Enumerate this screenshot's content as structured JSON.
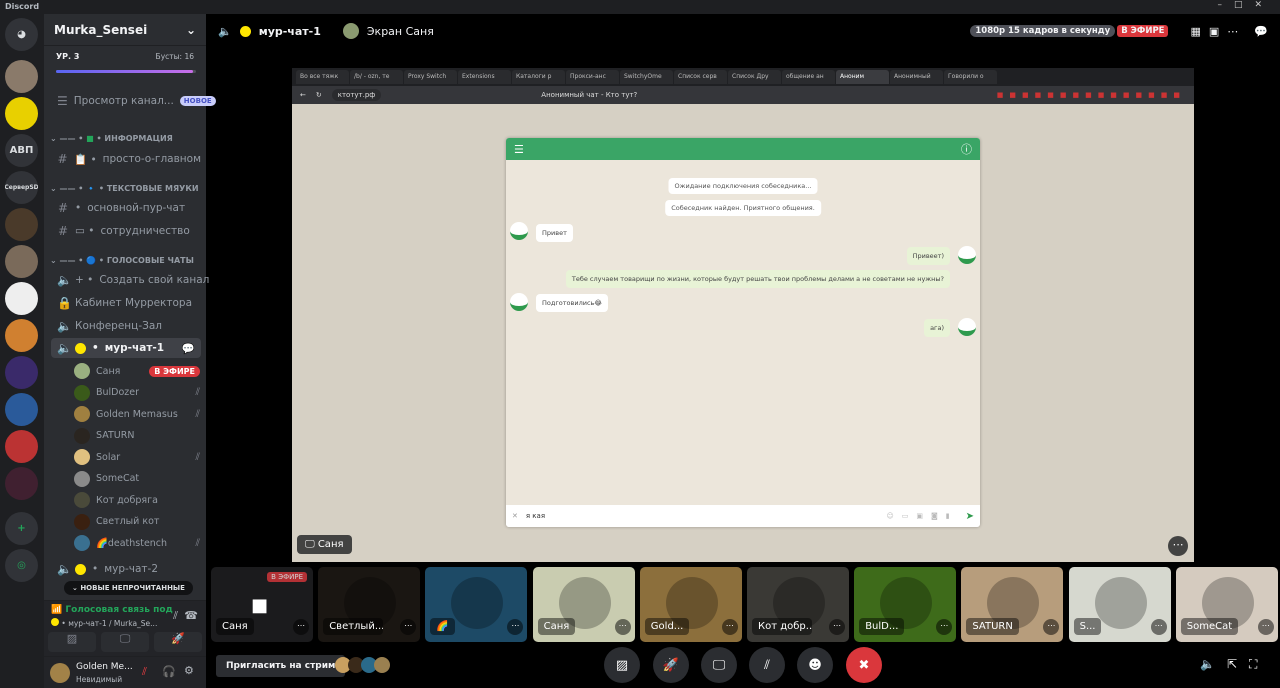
{
  "app": {
    "title": "Discord"
  },
  "rail": {
    "servers": [
      {
        "label": ""
      },
      {
        "label": ""
      },
      {
        "label": "АВП"
      },
      {
        "label": "СерверSD"
      },
      {
        "label": ""
      },
      {
        "label": ""
      },
      {
        "label": ""
      },
      {
        "label": ""
      },
      {
        "label": ""
      },
      {
        "label": ""
      },
      {
        "label": ""
      },
      {
        "label": ""
      }
    ]
  },
  "server": {
    "name": "Murka_Sensei",
    "level": "УР. 3",
    "boosts": "Бусты: 16",
    "boost_progress": 0.98,
    "browse": "Просмотр канал...",
    "browse_badge": "НОВОЕ"
  },
  "categories": {
    "info": "ИНФОРМАЦИЯ",
    "text": "ТЕКСТОВЫЕ МЯУКИ",
    "voice": "ГОЛОСОВЫЕ ЧАТЫ"
  },
  "channels": {
    "main": "просто-о-главном",
    "purr": "основной-пур-чат",
    "coop": "сотрудничество",
    "create": "Создать свой канал",
    "cabinet": "Кабинет Мурректора",
    "conf": "Конференц-Зал",
    "mur1": "мур-чат-1",
    "mur2": "мур-чат-2"
  },
  "voice_users": [
    {
      "name": "Саня",
      "live": "В ЭФИРЕ",
      "muted": false
    },
    {
      "name": "BulDozer",
      "muted": true
    },
    {
      "name": "Golden Memasus",
      "muted": true
    },
    {
      "name": "SATURN",
      "muted": false
    },
    {
      "name": "Solar",
      "muted": true
    },
    {
      "name": "SomeCat",
      "muted": false
    },
    {
      "name": "Кот добряга",
      "muted": false
    },
    {
      "name": "Светлый кот",
      "muted": false
    },
    {
      "name": "🌈deathstench",
      "muted": true
    }
  ],
  "unread_pill": "НОВЫЕ НЕПРОЧИТАННЫЕ",
  "voice_status": {
    "title": "Голосовая связь под",
    "location": "мур-чат-1 / Murka_Se..."
  },
  "user": {
    "name": "Golden Me...",
    "status": "Невидимый"
  },
  "header": {
    "channel": "мур-чат-1",
    "stream_of": "Экран Саня",
    "quality": "1080p 15 кадров в секунду",
    "live": "В ЭФИРЕ"
  },
  "browser": {
    "tabs": [
      "Во все тяжк",
      "/b/ - ozn, те",
      "Proxy Switch",
      "Extensions",
      "Каталоги р",
      "Прокси-анс",
      "SwitchyOme",
      "Список серв",
      "Список Дру",
      "общение ан",
      "Аноним",
      "Анонимный",
      "Говорили о"
    ],
    "url": "ктотут.рф",
    "page_title": "Анонимный чат - Кто тут?"
  },
  "chat": {
    "system": [
      "Ожидание подключения собеседника...",
      "Собеседник найден. Приятного общения."
    ],
    "messages": [
      {
        "dir": "in",
        "text": "Привет"
      },
      {
        "dir": "out",
        "text": "Привеет)"
      },
      {
        "dir": "out",
        "text": "Тебе случаем товарищи по жизни, которые будут решать твои проблемы делами а не советами не нужны?"
      },
      {
        "dir": "in",
        "text": "Подготовились😂"
      },
      {
        "dir": "out",
        "text": "ага)"
      }
    ],
    "input_value": "я кая"
  },
  "stream_label": "Саня",
  "tiles": [
    {
      "name": "Саня",
      "badge": "В ЭФИРЕ",
      "bg": "#1b1b1d"
    },
    {
      "name": "Светлый...",
      "bg": "#1a1612"
    },
    {
      "name": "🌈",
      "bg": "#1d4a66"
    },
    {
      "name": "Саня",
      "bg": "#c9ccb0"
    },
    {
      "name": "Gold...",
      "bg": "#8c6f3c"
    },
    {
      "name": "Кот добр...",
      "bg": "#3a3935"
    },
    {
      "name": "BulD...",
      "bg": "#3e6b1a"
    },
    {
      "name": "SATURN",
      "bg": "#b79d7c"
    },
    {
      "name": "S...",
      "bg": "#d6d8cf"
    },
    {
      "name": "SomeCat",
      "bg": "#d5cbbf"
    }
  ],
  "footer": {
    "invite": "Пригласить на стрим"
  }
}
